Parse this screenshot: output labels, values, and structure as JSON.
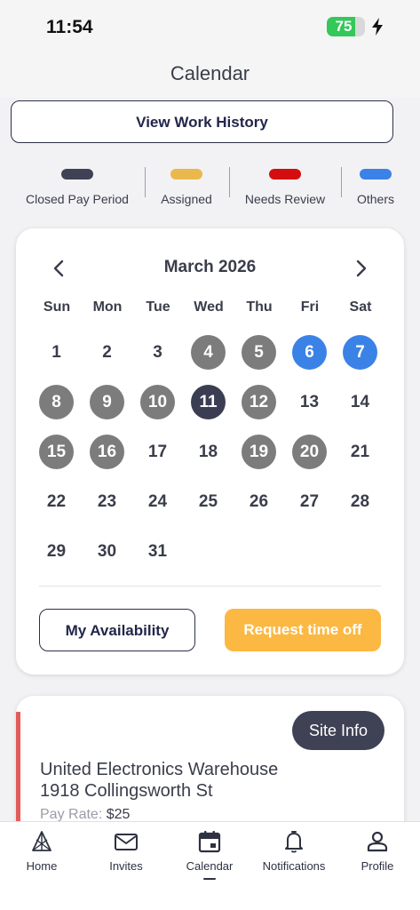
{
  "status_bar": {
    "time": "11:54",
    "battery_level": "75",
    "battery_fraction": 0.75
  },
  "header": {
    "title": "Calendar"
  },
  "actions": {
    "view_work_history": "View Work History"
  },
  "legend": [
    {
      "label": "Closed Pay Period",
      "color": "#3f4154"
    },
    {
      "label": "Assigned",
      "color": "#eab84c"
    },
    {
      "label": "Needs Review",
      "color": "#d40e0e"
    },
    {
      "label": "Others",
      "color": "#3b82e6"
    }
  ],
  "calendar": {
    "month_title": "March 2026",
    "weekdays": [
      "Sun",
      "Mon",
      "Tue",
      "Wed",
      "Thu",
      "Fri",
      "Sat"
    ],
    "first_weekday_index": 0,
    "days": [
      {
        "day": "1",
        "status": "none"
      },
      {
        "day": "2",
        "status": "none"
      },
      {
        "day": "3",
        "status": "none"
      },
      {
        "day": "4",
        "status": "closed"
      },
      {
        "day": "5",
        "status": "closed"
      },
      {
        "day": "6",
        "status": "others"
      },
      {
        "day": "7",
        "status": "others"
      },
      {
        "day": "8",
        "status": "closed"
      },
      {
        "day": "9",
        "status": "closed"
      },
      {
        "day": "10",
        "status": "closed"
      },
      {
        "day": "11",
        "status": "today"
      },
      {
        "day": "12",
        "status": "closed"
      },
      {
        "day": "13",
        "status": "none"
      },
      {
        "day": "14",
        "status": "none"
      },
      {
        "day": "15",
        "status": "closed"
      },
      {
        "day": "16",
        "status": "closed"
      },
      {
        "day": "17",
        "status": "none"
      },
      {
        "day": "18",
        "status": "none"
      },
      {
        "day": "19",
        "status": "closed"
      },
      {
        "day": "20",
        "status": "closed"
      },
      {
        "day": "21",
        "status": "none"
      },
      {
        "day": "22",
        "status": "none"
      },
      {
        "day": "23",
        "status": "none"
      },
      {
        "day": "24",
        "status": "none"
      },
      {
        "day": "25",
        "status": "none"
      },
      {
        "day": "26",
        "status": "none"
      },
      {
        "day": "27",
        "status": "none"
      },
      {
        "day": "28",
        "status": "none"
      },
      {
        "day": "29",
        "status": "none"
      },
      {
        "day": "30",
        "status": "none"
      },
      {
        "day": "31",
        "status": "none"
      }
    ],
    "my_availability": "My Availability",
    "request_time_off": "Request time off"
  },
  "job": {
    "site_info": "Site Info",
    "name": "United Electronics Warehouse",
    "address": "1918 Collingsworth St",
    "pay_rate_label": "Pay Rate:",
    "pay_rate_value": "$25"
  },
  "tabs": [
    {
      "label": "Home",
      "icon": "home-icon",
      "active": false
    },
    {
      "label": "Invites",
      "icon": "mail-icon",
      "active": false
    },
    {
      "label": "Calendar",
      "icon": "calendar-icon",
      "active": true
    },
    {
      "label": "Notifications",
      "icon": "bell-icon",
      "active": false
    },
    {
      "label": "Profile",
      "icon": "person-icon",
      "active": false
    }
  ]
}
